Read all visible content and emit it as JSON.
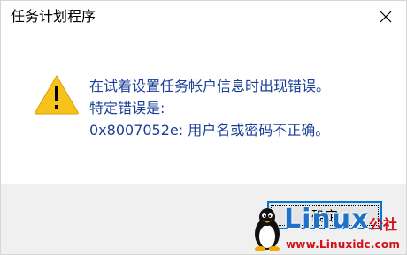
{
  "window": {
    "title": "任务计划程序"
  },
  "message": {
    "icon": "warning-icon",
    "lines": [
      "在试着设置任务帐户信息时出现错误。",
      "特定错误是:",
      "0x8007052e: 用户名或密码不正确。"
    ]
  },
  "buttons": {
    "ok_label": "确定"
  },
  "watermark": {
    "brand": "Linux",
    "suffix": "公社",
    "url": "www.Linuxidc.com"
  },
  "colors": {
    "message_text": "#1a3f98",
    "warning_fill": "#f7c21a",
    "button_border": "#0078d7",
    "footer_bg": "#f0f0f0",
    "watermark_blue": "#1e73c8",
    "watermark_red": "#d0101a"
  }
}
